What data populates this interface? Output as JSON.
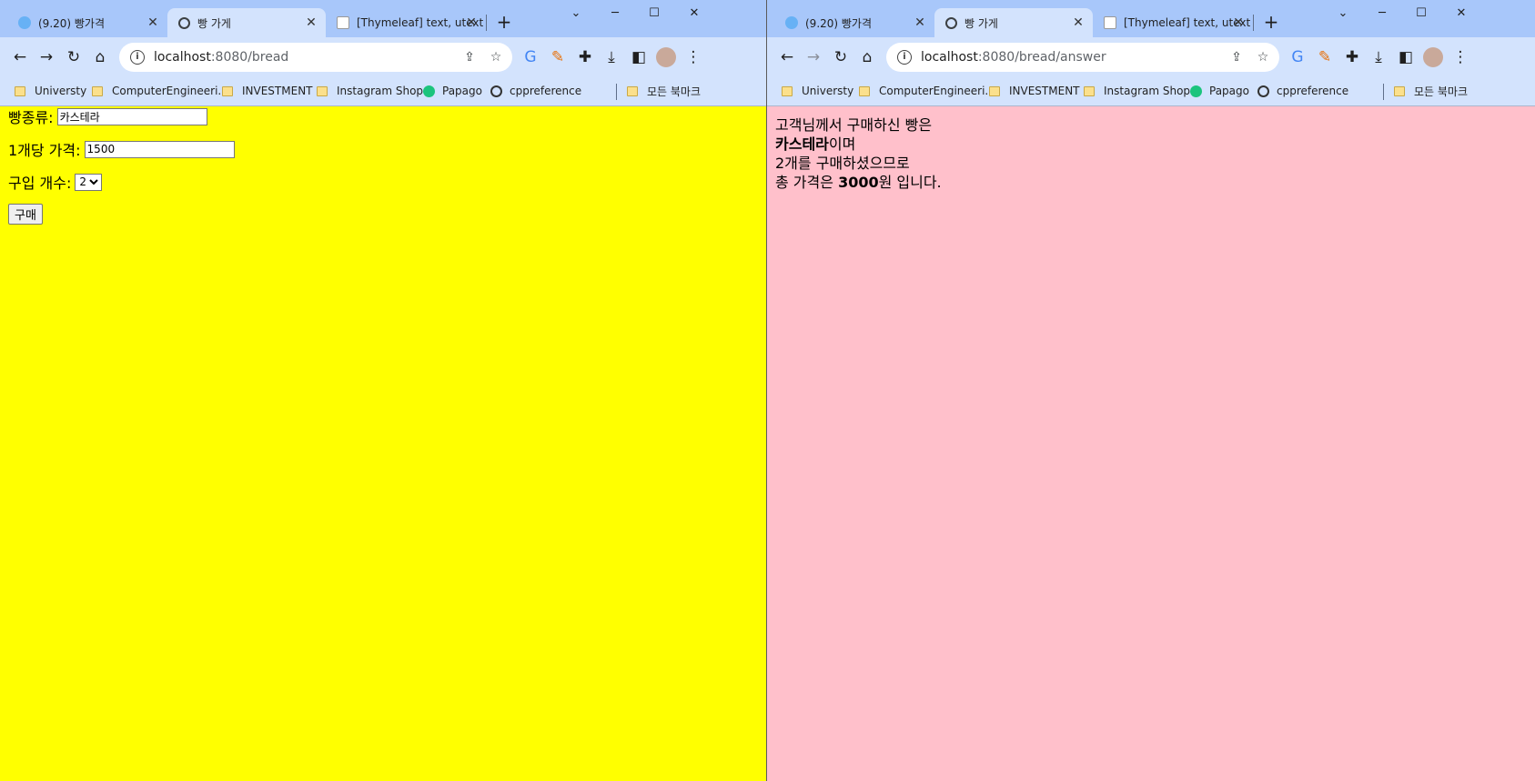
{
  "left": {
    "tabs": [
      {
        "label": "(9.20) 빵가격"
      },
      {
        "label": "빵 가게"
      },
      {
        "label": "[Thymeleaf] text, utext"
      }
    ],
    "url_host": "localhost",
    "url_path": ":8080/bread",
    "bookmarks": [
      "Universty",
      "ComputerEngineeri...",
      "INVESTMENT",
      "Instagram Shop",
      "Papago",
      "cppreference"
    ],
    "all_bookmarks": "모든 북마크",
    "form": {
      "bread_label": "빵종류:",
      "bread_value": "카스테라",
      "price_label": "1개당 가격:",
      "price_value": "1500",
      "count_label": "구입 개수:",
      "count_value": "2",
      "submit_label": "구매"
    },
    "bg_color": "#ffff00"
  },
  "right": {
    "tabs": [
      {
        "label": "(9.20) 빵가격"
      },
      {
        "label": "빵 가게"
      },
      {
        "label": "[Thymeleaf] text, utext"
      }
    ],
    "url_host": "localhost",
    "url_path": ":8080/bread/answer",
    "bookmarks": [
      "Universty",
      "ComputerEngineeri...",
      "INVESTMENT",
      "Instagram Shop",
      "Papago",
      "cppreference"
    ],
    "all_bookmarks": "모든 북마크",
    "answer": {
      "line1": "고객님께서 구매하신 빵은",
      "bread": "카스테라",
      "line2_suffix": "이며",
      "line3": "2개를 구매하셨으므로",
      "line4_prefix": "총 가격은 ",
      "total": "3000",
      "line4_suffix": "원 입니다."
    },
    "bg_color": "#ffc0cb"
  },
  "icons": {
    "back": "arrow-left-icon",
    "forward": "arrow-right-icon",
    "reload": "reload-icon",
    "home": "home-icon",
    "share": "share-icon",
    "star": "star-icon",
    "translate": "translate-icon",
    "extensions": "puzzle-icon",
    "download": "download-icon",
    "sidepanel": "side-panel-icon",
    "menu": "kebab-menu-icon"
  }
}
